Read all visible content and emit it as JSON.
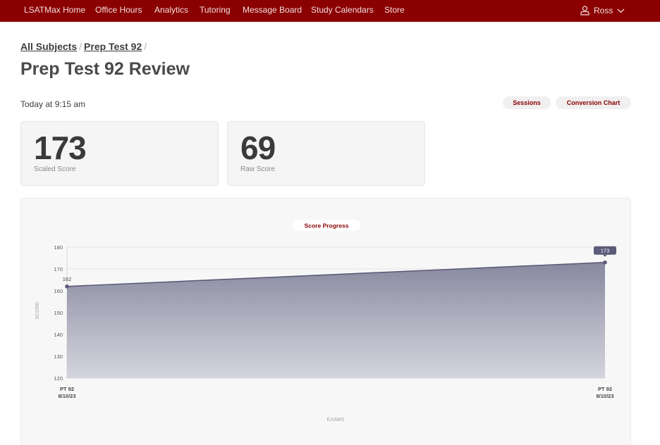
{
  "nav": {
    "links": [
      "LSATMax Home",
      "Office Hours",
      "Analytics",
      "Tutoring",
      "Message Board",
      "Study Calendars",
      "Store"
    ],
    "user_name": "Ross"
  },
  "breadcrumb": {
    "all_subjects": "All Subjects",
    "prep_test": "Prep Test 92",
    "separator": "/"
  },
  "page": {
    "title": "Prep Test 92 Review",
    "timestamp": "Today at 9:15 am"
  },
  "actions": {
    "sessions": "Sessions",
    "conversion_chart": "Conversion Chart"
  },
  "scores": {
    "scaled": {
      "value": "173",
      "label": "Scaled Score"
    },
    "raw": {
      "value": "69",
      "label": "Raw Score"
    }
  },
  "colors": {
    "brand": "#8b0000",
    "series": "#5b5b7a"
  },
  "chart_data": {
    "type": "area",
    "title": "Score Progress",
    "xlabel": "EXAMS",
    "ylabel": "SCORE",
    "ylim": [
      120,
      180
    ],
    "yticks": [
      120,
      130,
      140,
      150,
      160,
      170,
      180
    ],
    "categories": [
      {
        "line1": "PT 92",
        "line2": "8/10/23"
      },
      {
        "line1": "PT 92",
        "line2": "8/10/23"
      }
    ],
    "values": [
      162,
      173
    ],
    "data_labels": [
      "162",
      "173"
    ],
    "grid": true
  }
}
